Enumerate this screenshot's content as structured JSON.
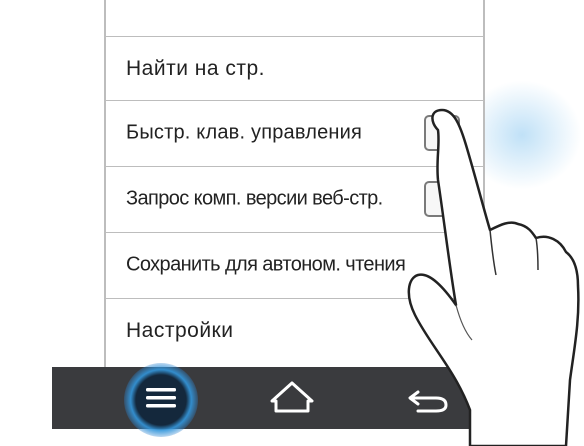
{
  "menu": {
    "items": [
      {
        "label": "Найти на стр.",
        "checkbox": false
      },
      {
        "label": "Быстр. клав. управления",
        "checkbox": true
      },
      {
        "label": "Запрос комп. версии веб-стр.",
        "checkbox": true
      },
      {
        "label": "Сохранить для автоном. чтения",
        "checkbox": false
      },
      {
        "label": "Настройки",
        "checkbox": false
      }
    ]
  },
  "navbar": {
    "buttons": [
      "menu-icon",
      "home-icon",
      "back-icon"
    ]
  },
  "colors": {
    "navbar": "#3a3b3e",
    "divider": "#bdbdbd",
    "menu_glow": "#3296dc"
  }
}
